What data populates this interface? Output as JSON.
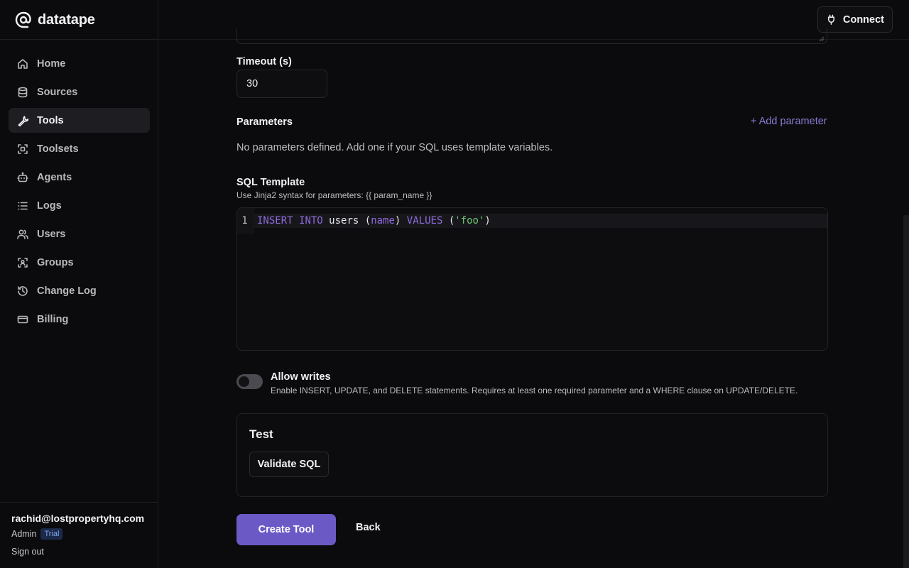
{
  "brand": {
    "name": "datatape",
    "logo_icon": "spiral-at-icon"
  },
  "header": {
    "connect_label": "Connect",
    "connect_icon": "plug-icon"
  },
  "sidebar": {
    "items": [
      {
        "label": "Home",
        "icon": "home-icon",
        "active": false
      },
      {
        "label": "Sources",
        "icon": "database-icon",
        "active": false
      },
      {
        "label": "Tools",
        "icon": "wrench-icon",
        "active": true
      },
      {
        "label": "Toolsets",
        "icon": "scan-icon",
        "active": false
      },
      {
        "label": "Agents",
        "icon": "bot-icon",
        "active": false
      },
      {
        "label": "Logs",
        "icon": "list-icon",
        "active": false
      },
      {
        "label": "Users",
        "icon": "users-icon",
        "active": false
      },
      {
        "label": "Groups",
        "icon": "user-scan-icon",
        "active": false
      },
      {
        "label": "Change Log",
        "icon": "history-icon",
        "active": false
      },
      {
        "label": "Billing",
        "icon": "credit-card-icon",
        "active": false
      }
    ],
    "user": {
      "email": "rachid@lostpropertyhq.com",
      "role": "Admin",
      "badge": "Trial",
      "sign_out": "Sign out"
    }
  },
  "form": {
    "timeout": {
      "label": "Timeout (s)",
      "value": "30"
    },
    "parameters": {
      "label": "Parameters",
      "add_label": "+ Add parameter",
      "empty_text": "No parameters defined. Add one if your SQL uses template variables."
    },
    "sql": {
      "label": "SQL Template",
      "hint": "Use Jinja2 syntax for parameters: {{ param_name }}",
      "line_number": "1",
      "tokens": {
        "kw1": "INSERT",
        "kw2": "INTO",
        "table": "users",
        "open1": "(",
        "col": "name",
        "close1": ")",
        "kw3": "VALUES",
        "open2": "(",
        "value": "'foo'",
        "close2": ")"
      }
    },
    "allow_writes": {
      "label": "Allow writes",
      "description": "Enable INSERT, UPDATE, and DELETE statements. Requires at least one required parameter and a WHERE clause on UPDATE/DELETE.",
      "enabled": false
    },
    "test": {
      "title": "Test",
      "validate_label": "Validate SQL"
    },
    "actions": {
      "create_label": "Create Tool",
      "back_label": "Back"
    }
  },
  "colors": {
    "accent": "#6b5ac6",
    "link": "#8b7cd6",
    "background": "#0b0b0d"
  }
}
